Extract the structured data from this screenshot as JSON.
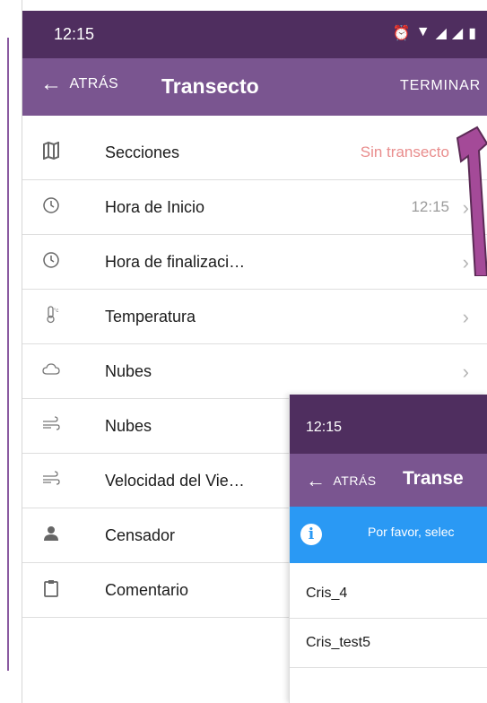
{
  "status_bar": {
    "time": "12:15"
  },
  "app_bar": {
    "back_label": "ATRÁS",
    "title": "Transecto",
    "finish_label": "TERMINAR"
  },
  "rows": [
    {
      "icon": "map-icon",
      "label": "Secciones",
      "value": "Sin transecto"
    },
    {
      "icon": "clock-icon",
      "label": "Hora de Inicio",
      "value": "12:15"
    },
    {
      "icon": "clock-icon",
      "label": "Hora de finalizaci…",
      "value": ""
    },
    {
      "icon": "thermometer-icon",
      "label": "Temperatura",
      "value": ""
    },
    {
      "icon": "cloud-icon",
      "label": "Nubes",
      "value": ""
    },
    {
      "icon": "wind-icon",
      "label": "Nubes",
      "value": ""
    },
    {
      "icon": "wind-icon",
      "label": "Velocidad del Vie…",
      "value": ""
    },
    {
      "icon": "person-icon",
      "label": "Censador",
      "value": ""
    },
    {
      "icon": "clipboard-icon",
      "label": "Comentario",
      "value": ""
    }
  ],
  "overlay": {
    "time": "12:15",
    "back_label": "ATRÁS",
    "title": "Transe",
    "info_text": "Por favor, selec",
    "items": [
      "Cris_4",
      "Cris_test5"
    ]
  },
  "colors": {
    "status_bar": "#4f2e5f",
    "app_bar": "#7a5590",
    "info_banner": "#2a99f4",
    "error_text": "#e98d8d",
    "annotation_arrow": "#a44a98"
  }
}
